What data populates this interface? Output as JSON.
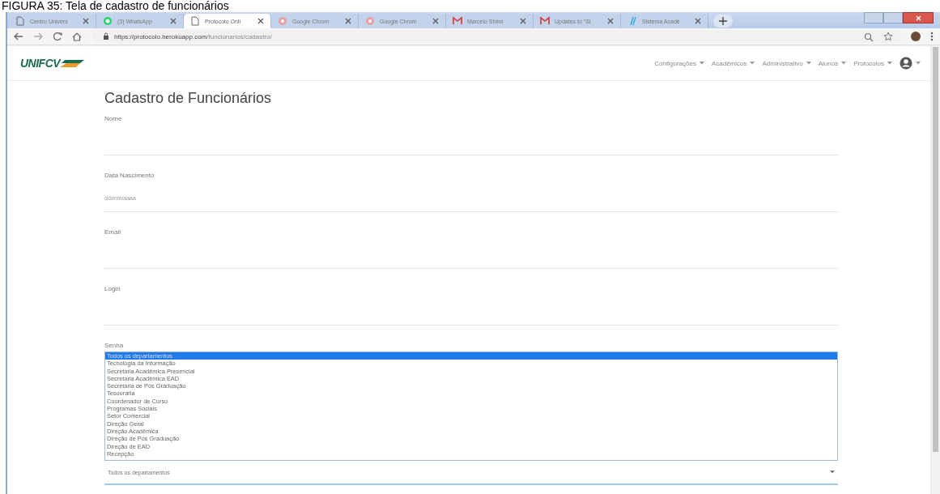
{
  "caption": "FIGURA 35: Tela de cadastro de funcionários",
  "browser": {
    "tabs": [
      {
        "title": "Centro Univers",
        "kind": "page",
        "selected": false
      },
      {
        "title": "(3) WhatsApp",
        "kind": "chat",
        "selected": false
      },
      {
        "title": "Protocolo Onli",
        "kind": "page",
        "selected": true
      },
      {
        "title": "Google Chrom",
        "kind": "chrome",
        "selected": false
      },
      {
        "title": "Google Chrom",
        "kind": "chrome",
        "selected": false
      },
      {
        "title": "Marcelo Shimi",
        "kind": "mail",
        "selected": false
      },
      {
        "title": "Updates to \"Si",
        "kind": "mail",
        "selected": false
      },
      {
        "title": "Sistema Acadê",
        "kind": "slash",
        "selected": false
      }
    ],
    "url_host": "https://protocolo.herokuapp.com",
    "url_path": "/funcionarios/cadastro/"
  },
  "navbar": {
    "logo": "UNIFCV",
    "menus": [
      "Configurações",
      "Acadêmicos",
      "Administrativo",
      "Alunos",
      "Protocolos"
    ]
  },
  "form": {
    "title": "Cadastro de Funcionários",
    "fields": [
      {
        "label": "Nome",
        "kind": "text"
      },
      {
        "label": "Data Nascimento",
        "kind": "date",
        "placeholder": "dd/mm/aaaa"
      },
      {
        "label": "Email",
        "kind": "text"
      },
      {
        "label": "Login",
        "kind": "text"
      },
      {
        "label": "Senha",
        "kind": "label"
      }
    ],
    "department_list": [
      {
        "label": "Todos os departamentos",
        "selected": true
      },
      {
        "label": "Tecnologia da Informação",
        "selected": false
      },
      {
        "label": "Secretaria Acadêmica Presencial",
        "selected": false
      },
      {
        "label": "Secretaria Acadêmica EAD",
        "selected": false
      },
      {
        "label": "Secretaria de Pós Graduação",
        "selected": false
      },
      {
        "label": "Tesouraria",
        "selected": false
      },
      {
        "label": "Coordenador de Curso",
        "selected": false
      },
      {
        "label": "Programas Sociais",
        "selected": false
      },
      {
        "label": "Setor Comercial",
        "selected": false
      },
      {
        "label": "Direção Geral",
        "selected": false
      },
      {
        "label": "Direção Acadêmica",
        "selected": false
      },
      {
        "label": "Direção de Pós Graduação",
        "selected": false
      },
      {
        "label": "Direção de EAD",
        "selected": false
      },
      {
        "label": "Recepção",
        "selected": false
      }
    ],
    "department_select": {
      "value": "Todos os departamentos",
      "focused": true
    }
  }
}
